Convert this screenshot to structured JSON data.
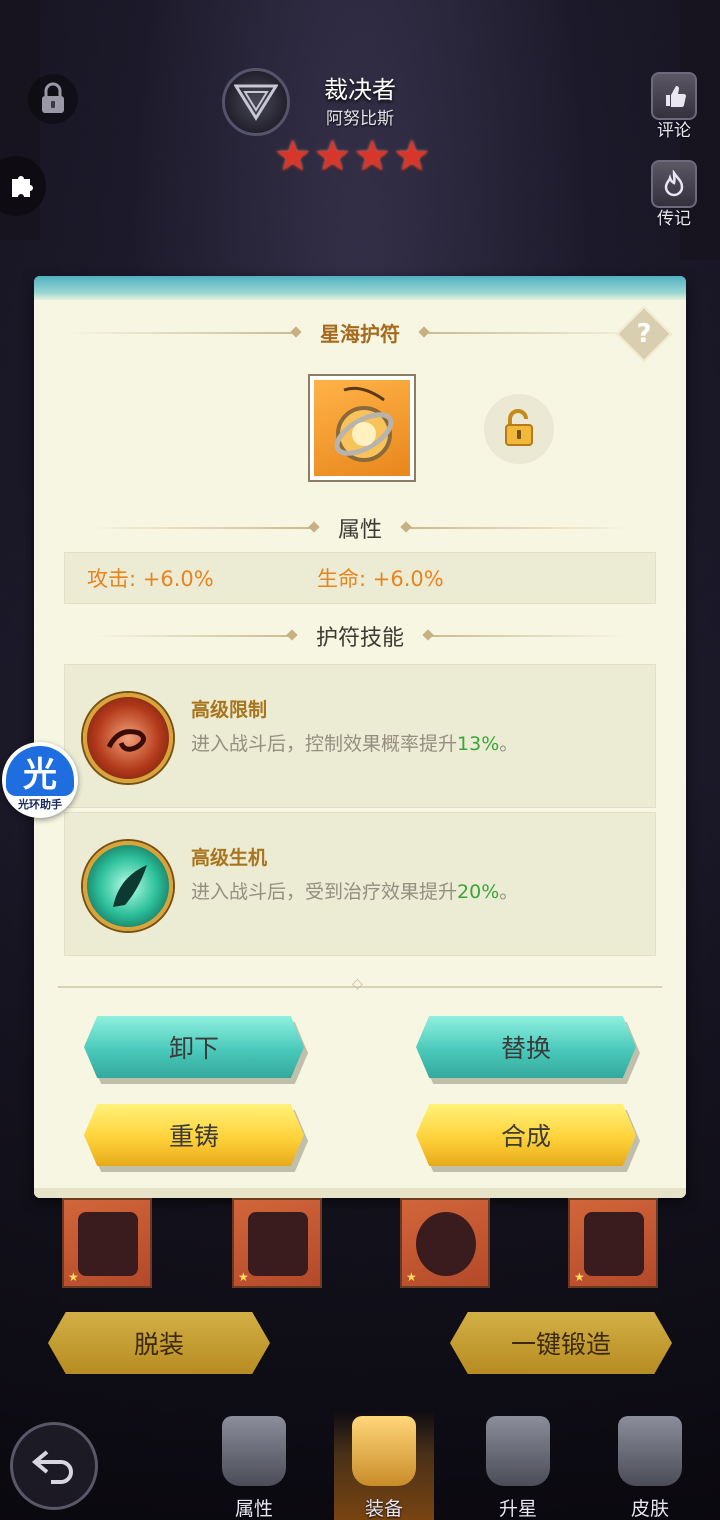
{
  "hero": {
    "title": "裁决者",
    "subtitle": "阿努比斯",
    "stars": 4
  },
  "side": {
    "comment_label": "评论",
    "biography_label": "传记"
  },
  "helper": {
    "glyph": "光",
    "caption": "光环助手"
  },
  "panel": {
    "amulet_name": "星海护符",
    "help_glyph": "?",
    "attributes_heading": "属性",
    "attributes": [
      {
        "label": "攻击: +6.0%"
      },
      {
        "label": "生命: +6.0%"
      }
    ],
    "skills_heading": "护符技能",
    "skills": [
      {
        "name": "高级限制",
        "desc_prefix": "进入战斗后，控制效果概率提升",
        "pct": "13%",
        "desc_suffix": "。"
      },
      {
        "name": "高级生机",
        "desc_prefix": "进入战斗后，受到治疗效果提升",
        "pct": "20%",
        "desc_suffix": "。"
      }
    ],
    "buttons": {
      "unequip": "卸下",
      "replace": "替换",
      "reforge": "重铸",
      "synthesize": "合成"
    }
  },
  "bottom": {
    "remove_all": "脱装",
    "one_click_forge": "一键锻造",
    "tabs": [
      {
        "label": "属性"
      },
      {
        "label": "装备"
      },
      {
        "label": "升星"
      },
      {
        "label": "皮肤"
      }
    ]
  },
  "colors": {
    "teal_button": "#4ac9bb",
    "gold_button": "#ffd23a",
    "attr_orange": "#e8841f",
    "skill_name": "#a8751f",
    "pct_green": "#3aa53a",
    "star_red": "#d7372b"
  },
  "icons": {
    "lock": "lock-icon",
    "class": "class-emblem-icon",
    "comment": "thumbs-up-book-icon",
    "biography": "flame-book-icon",
    "puzzle": "puzzle-icon",
    "unlock": "unlock-icon",
    "help": "question-icon",
    "back": "back-arrow-icon"
  }
}
